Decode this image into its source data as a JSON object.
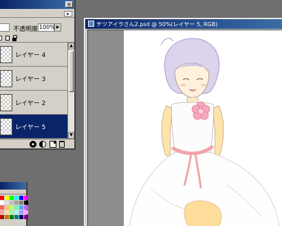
{
  "layers_panel": {
    "blend_mode_fragment": "",
    "opacity_label": "不透明度:",
    "opacity_value": "100%",
    "layers": [
      {
        "name": "レイヤー 4",
        "selected": false
      },
      {
        "name": "レイヤー 3",
        "selected": false
      },
      {
        "name": "レイヤー 2",
        "selected": false
      },
      {
        "name": "レイヤー 5",
        "selected": true
      }
    ]
  },
  "document": {
    "title": "チツアイラさん2.psd @ 50%(レイヤー 5, RGB)"
  },
  "swatches": {
    "colors": [
      "#ff0000",
      "#ffff00",
      "#00ff00",
      "#00ffff",
      "#0000ff",
      "#ff00ff",
      "#ffffff",
      "#e0e0e0",
      "#c0c0c0",
      "#a0a0a0",
      "#808080",
      "#000000",
      "#ff6060",
      "#ffc060",
      "#c0ff60",
      "#60ffc0",
      "#60a0ff",
      "#c060ff",
      "#ffa0a0",
      "#ffe0a0",
      "#a0ffa0",
      "#a0ffff",
      "#a0a0ff",
      "#ffa0ff",
      "#c00000",
      "#c08000",
      "#008000",
      "#008080",
      "#000080",
      "#800080"
    ]
  },
  "colors": {
    "titlebar_start": "#0a246a",
    "titlebar_end": "#3a6ea5",
    "selection": "#0a246a",
    "panel_bg": "#d4d0c8",
    "workspace_bg": "#8d8d8d",
    "canvas_bg": "#ffffff"
  }
}
